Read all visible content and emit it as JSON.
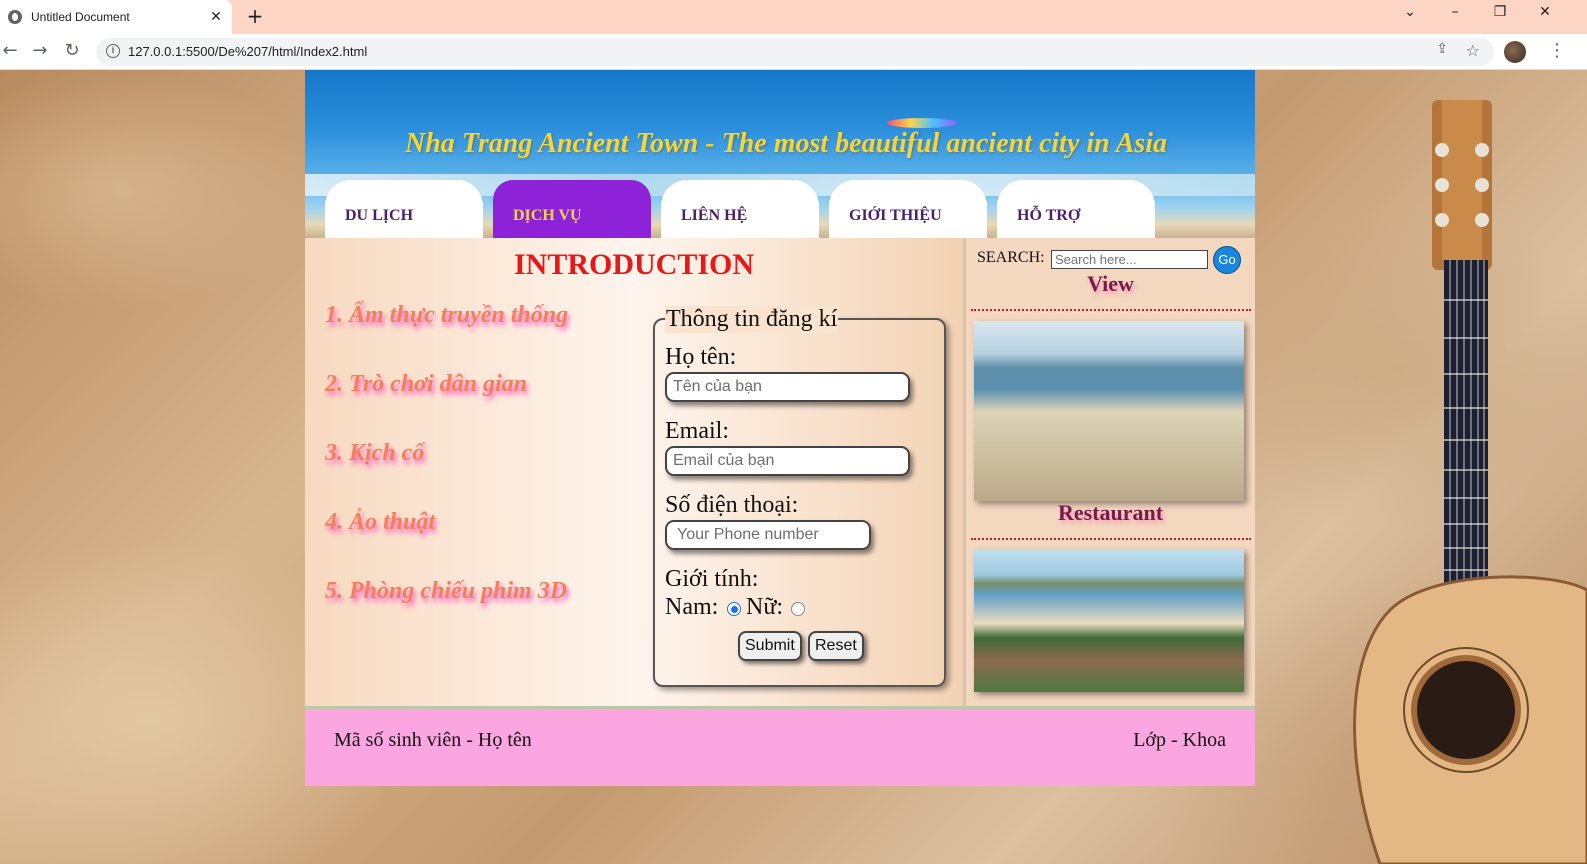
{
  "browser": {
    "tab_title": "Untitled Document",
    "url": "127.0.0.1:5500/De%207/html/Index2.html"
  },
  "banner": {
    "title": "Nha Trang Ancient Town - The most beautiful ancient city in Asia"
  },
  "menu": [
    {
      "label": "DU LỊCH",
      "active": false
    },
    {
      "label": "DỊCH VỤ",
      "active": true
    },
    {
      "label": "LIÊN HỆ",
      "active": false
    },
    {
      "label": "GIỚI THIỆU",
      "active": false
    },
    {
      "label": "HỖ TRỢ",
      "active": false
    }
  ],
  "main": {
    "title": "INTRODUCTION",
    "items": [
      "1. Ẩm thực truyền thống",
      "2. Trò chơi dân gian",
      "3. Kịch cổ",
      "4. Ảo thuật",
      "5. Phòng chiếu phim 3D"
    ]
  },
  "form": {
    "legend": "Thông tin đăng kí",
    "name_label": "Họ tên:",
    "name_placeholder": "Tên của bạn",
    "email_label": "Email:",
    "email_placeholder": "Email của bạn",
    "phone_label": "Số điện thoại:",
    "phone_placeholder": "Your Phone number",
    "gender_label": "Giới tính:",
    "male_label": "Nam:",
    "female_label": "Nữ:",
    "gender_selected": "Nam",
    "submit_label": "Submit",
    "reset_label": "Reset"
  },
  "aside": {
    "search_label": "SEARCH:",
    "search_placeholder": "Search here...",
    "go_label": "Go",
    "view_label": "View",
    "caption": "Restaurant"
  },
  "footer": {
    "left": "Mã số sinh viên - Họ tên",
    "right": "Lớp - Khoa"
  },
  "colors": {
    "menu_active_bg": "#8e22d8",
    "menu_active_text": "#f6d24a",
    "intro_title": "#e81818",
    "intro_items": "#f4805a",
    "footer_bg": "#fba6e0"
  }
}
